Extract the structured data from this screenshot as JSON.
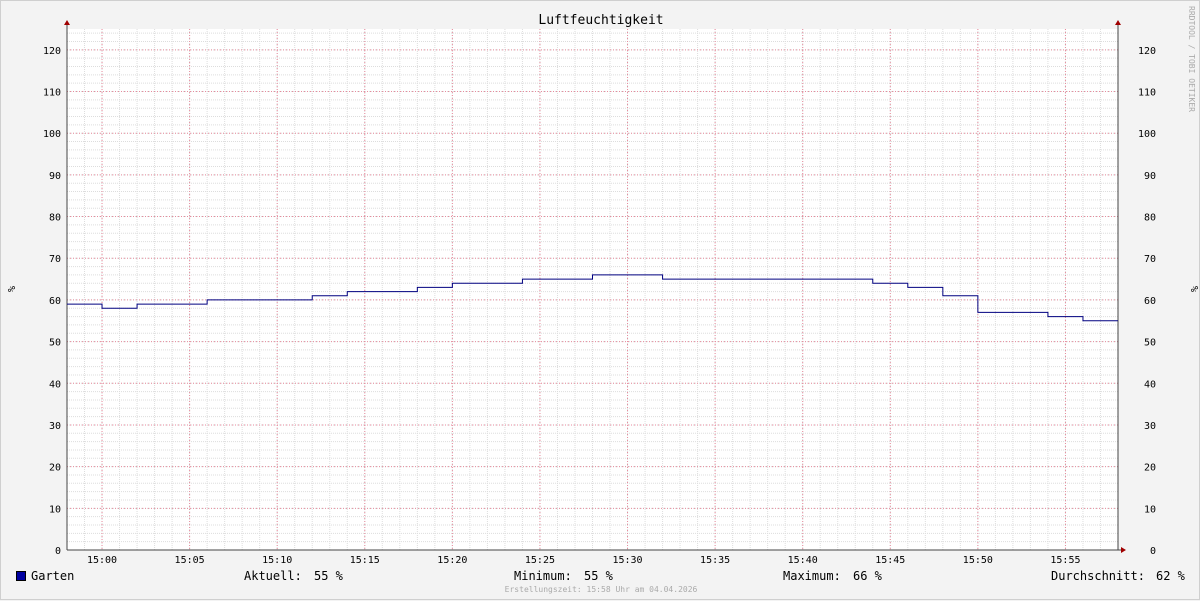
{
  "chart_data": {
    "type": "line",
    "title": "Luftfeuchtigkeit",
    "ylabel": "%",
    "ylim": [
      0,
      125
    ],
    "yticks": [
      0,
      10,
      20,
      30,
      40,
      50,
      60,
      70,
      80,
      90,
      100,
      110,
      120
    ],
    "xticks": [
      "15:00",
      "15:05",
      "15:10",
      "15:15",
      "15:20",
      "15:25",
      "15:30",
      "15:35",
      "15:40",
      "15:45",
      "15:50",
      "15:55"
    ],
    "xlim": [
      "14:58",
      "15:58"
    ],
    "grid": true,
    "series": [
      {
        "name": "Garten",
        "color": "#000080",
        "x": [
          "14:58",
          "15:00",
          "15:02",
          "15:04",
          "15:06",
          "15:08",
          "15:10",
          "15:12",
          "15:14",
          "15:16",
          "15:18",
          "15:20",
          "15:22",
          "15:24",
          "15:26",
          "15:28",
          "15:30",
          "15:32",
          "15:34",
          "15:36",
          "15:38",
          "15:40",
          "15:42",
          "15:44",
          "15:46",
          "15:48",
          "15:50",
          "15:52",
          "15:54",
          "15:56"
        ],
        "values": [
          59,
          58,
          59,
          59,
          60,
          60,
          60,
          61,
          62,
          62,
          63,
          64,
          64,
          65,
          65,
          66,
          66,
          65,
          65,
          65,
          65,
          65,
          65,
          64,
          63,
          61,
          57,
          57,
          56,
          55
        ]
      }
    ],
    "watermark": "RRDTOOL / TOBI OETIKER"
  },
  "legend": {
    "series_name": "Garten",
    "swatch_color": "#0000a0",
    "current_label": "Aktuell:",
    "current_value": "55 %",
    "min_label": "Minimum:",
    "min_value": "55 %",
    "max_label": "Maximum:",
    "max_value": "66 %",
    "avg_label": "Durchschnitt:",
    "avg_value": "62 %"
  },
  "footer": {
    "created": "Erstellungszeit: 15:58 Uhr am 04.04.2026"
  }
}
